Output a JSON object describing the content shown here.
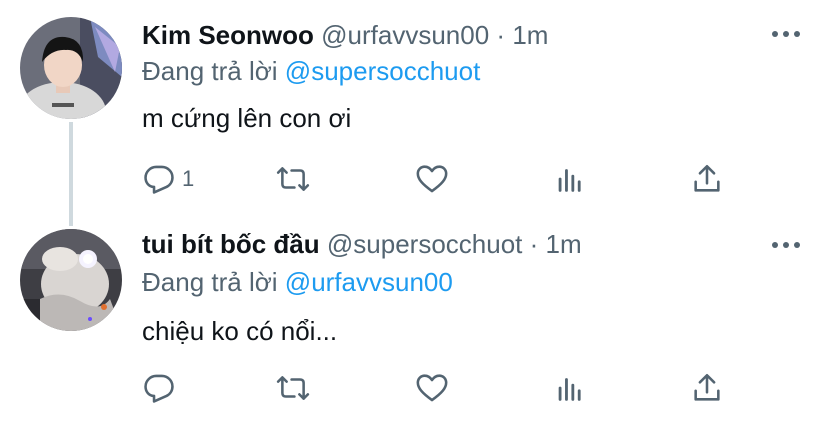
{
  "tweets": [
    {
      "display_name": "Kim Seonwoo",
      "handle": "@urfavvsun00",
      "separator": "·",
      "time": "1m",
      "reply_prefix": "Đang trả lời",
      "reply_to": "@supersocchuot",
      "text": "m cứng lên con ơi",
      "reply_count": "1",
      "avatar": "user-photo"
    },
    {
      "display_name": "tui bít bốc đầu",
      "handle": "@supersocchuot",
      "separator": "·",
      "time": "1m",
      "reply_prefix": "Đang trả lời",
      "reply_to": "@urfavvsun00",
      "text": "chiệu ko có nổi...",
      "reply_count": "",
      "avatar": "user-photo"
    }
  ],
  "icons": {
    "reply": "reply-icon",
    "retweet": "retweet-icon",
    "like": "heart-icon",
    "analytics": "analytics-icon",
    "share": "share-icon",
    "more": "more-icon"
  },
  "colors": {
    "text": "#0f1419",
    "secondary": "#536471",
    "link": "#1d9bf0",
    "thread_line": "#cfd9de"
  }
}
